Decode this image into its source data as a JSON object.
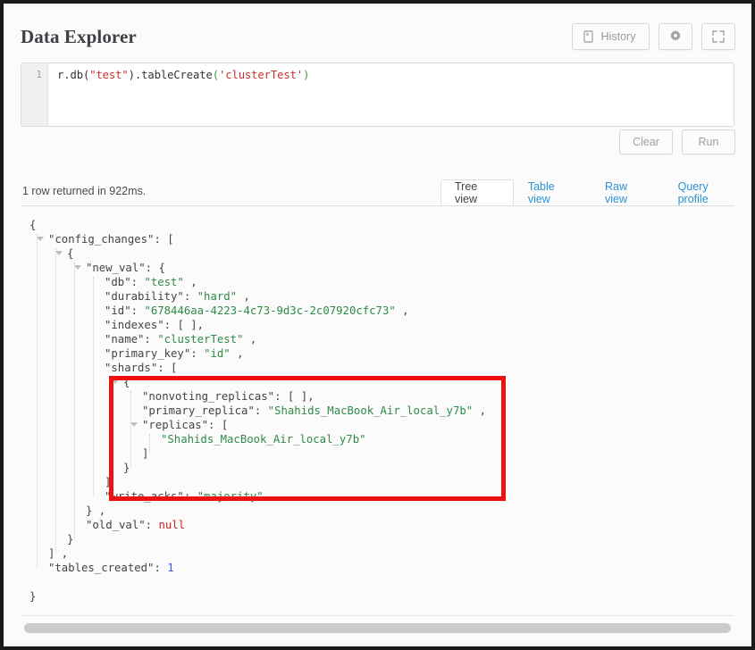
{
  "header": {
    "title": "Data Explorer",
    "buttons": [
      {
        "label": "History",
        "icon": "history-icon"
      },
      {
        "label": "",
        "icon": "gear-icon"
      },
      {
        "label": "",
        "icon": "expand-icon"
      }
    ]
  },
  "editor": {
    "line_number": "1",
    "tokens": [
      {
        "text": "r.db(",
        "type": "plain"
      },
      {
        "text": "\"test\"",
        "type": "string"
      },
      {
        "text": ").tableCreate",
        "type": "plain"
      },
      {
        "text": "(",
        "type": "paren"
      },
      {
        "text": "'clusterTest'",
        "type": "string"
      },
      {
        "text": ")",
        "type": "paren"
      }
    ],
    "full_query": "r.db(\"test\").tableCreate('clusterTest')"
  },
  "actions": {
    "clear_label": "Clear",
    "run_label": "Run"
  },
  "results": {
    "meta": "1 row returned in 922ms.",
    "tabs": [
      {
        "label": "Tree view",
        "active": true
      },
      {
        "label": "Table view",
        "active": false
      },
      {
        "label": "Raw view",
        "active": false
      },
      {
        "label": "Query profile",
        "active": false
      }
    ]
  },
  "tree_rows": [
    {
      "indent": 0,
      "tri": false,
      "parts": [
        {
          "t": "{",
          "c": "p"
        }
      ]
    },
    {
      "indent": 1,
      "tri": true,
      "parts": [
        {
          "t": "\"config_changes\"",
          "c": "k"
        },
        {
          "t": ": [",
          "c": "p"
        }
      ]
    },
    {
      "indent": 2,
      "tri": true,
      "parts": [
        {
          "t": "{",
          "c": "p"
        }
      ]
    },
    {
      "indent": 3,
      "tri": true,
      "parts": [
        {
          "t": "\"new_val\"",
          "c": "k"
        },
        {
          "t": ": {",
          "c": "p"
        }
      ]
    },
    {
      "indent": 4,
      "tri": false,
      "parts": [
        {
          "t": "\"db\"",
          "c": "k"
        },
        {
          "t": ": ",
          "c": "p"
        },
        {
          "t": "\"test\"",
          "c": "s"
        },
        {
          "t": " ,",
          "c": "p"
        }
      ]
    },
    {
      "indent": 4,
      "tri": false,
      "parts": [
        {
          "t": "\"durability\"",
          "c": "k"
        },
        {
          "t": ": ",
          "c": "p"
        },
        {
          "t": "\"hard\"",
          "c": "s"
        },
        {
          "t": " ,",
          "c": "p"
        }
      ]
    },
    {
      "indent": 4,
      "tri": false,
      "parts": [
        {
          "t": "\"id\"",
          "c": "k"
        },
        {
          "t": ": ",
          "c": "p"
        },
        {
          "t": "\"678446aa-4223-4c73-9d3c-2c07920cfc73\"",
          "c": "s"
        },
        {
          "t": " ,",
          "c": "p"
        }
      ]
    },
    {
      "indent": 4,
      "tri": false,
      "parts": [
        {
          "t": "\"indexes\"",
          "c": "k"
        },
        {
          "t": ": [ ],",
          "c": "p"
        }
      ]
    },
    {
      "indent": 4,
      "tri": false,
      "parts": [
        {
          "t": "\"name\"",
          "c": "k"
        },
        {
          "t": ": ",
          "c": "p"
        },
        {
          "t": "\"clusterTest\"",
          "c": "s"
        },
        {
          "t": " ,",
          "c": "p"
        }
      ]
    },
    {
      "indent": 4,
      "tri": false,
      "parts": [
        {
          "t": "\"primary_key\"",
          "c": "k"
        },
        {
          "t": ": ",
          "c": "p"
        },
        {
          "t": "\"id\"",
          "c": "s"
        },
        {
          "t": " ,",
          "c": "p"
        }
      ]
    },
    {
      "indent": 4,
      "tri": false,
      "parts": [
        {
          "t": "\"shards\"",
          "c": "k"
        },
        {
          "t": ": [",
          "c": "p"
        }
      ]
    },
    {
      "indent": 5,
      "tri": true,
      "parts": [
        {
          "t": "{",
          "c": "p"
        }
      ]
    },
    {
      "indent": 6,
      "tri": false,
      "parts": [
        {
          "t": "\"nonvoting_replicas\"",
          "c": "k"
        },
        {
          "t": ": [ ],",
          "c": "p"
        }
      ]
    },
    {
      "indent": 6,
      "tri": false,
      "parts": [
        {
          "t": "\"primary_replica\"",
          "c": "k"
        },
        {
          "t": ": ",
          "c": "p"
        },
        {
          "t": "\"Shahids_MacBook_Air_local_y7b\"",
          "c": "s"
        },
        {
          "t": " ,",
          "c": "p"
        }
      ]
    },
    {
      "indent": 6,
      "tri": true,
      "parts": [
        {
          "t": "\"replicas\"",
          "c": "k"
        },
        {
          "t": ": [",
          "c": "p"
        }
      ]
    },
    {
      "indent": 7,
      "tri": false,
      "parts": [
        {
          "t": "\"Shahids_MacBook_Air_local_y7b\"",
          "c": "s"
        }
      ]
    },
    {
      "indent": 6,
      "tri": false,
      "parts": [
        {
          "t": "]",
          "c": "p"
        }
      ]
    },
    {
      "indent": 5,
      "tri": false,
      "parts": [
        {
          "t": "}",
          "c": "p"
        }
      ]
    },
    {
      "indent": 4,
      "tri": false,
      "parts": [
        {
          "t": "]",
          "c": "p"
        }
      ]
    },
    {
      "indent": 4,
      "tri": false,
      "parts": [
        {
          "t": "\"write_acks\"",
          "c": "k"
        },
        {
          "t": ": ",
          "c": "p"
        },
        {
          "t": "\"majority\"",
          "c": "s"
        }
      ]
    },
    {
      "indent": 3,
      "tri": false,
      "parts": [
        {
          "t": "} ,",
          "c": "p"
        }
      ]
    },
    {
      "indent": 3,
      "tri": false,
      "parts": [
        {
          "t": "\"old_val\"",
          "c": "k"
        },
        {
          "t": ": ",
          "c": "p"
        },
        {
          "t": "null",
          "c": "nul"
        }
      ]
    },
    {
      "indent": 2,
      "tri": false,
      "parts": [
        {
          "t": "}",
          "c": "p"
        }
      ]
    },
    {
      "indent": 1,
      "tri": false,
      "parts": [
        {
          "t": "] ,",
          "c": "p"
        }
      ]
    },
    {
      "indent": 1,
      "tri": false,
      "parts": [
        {
          "t": "\"tables_created\"",
          "c": "k"
        },
        {
          "t": ": ",
          "c": "p"
        },
        {
          "t": "1",
          "c": "n"
        }
      ]
    },
    {
      "indent": 0,
      "tri": false,
      "parts": []
    },
    {
      "indent": 0,
      "tri": false,
      "parts": [
        {
          "t": "}",
          "c": "p"
        }
      ]
    }
  ],
  "colors": {
    "accent_link": "#2a92d4",
    "string_green": "#2e8b45",
    "number_blue": "#3b5bdb",
    "null_red": "#cc2222",
    "highlight_red": "#ee1111"
  },
  "highlight": {
    "note": "red annotation rectangle around shards block"
  }
}
